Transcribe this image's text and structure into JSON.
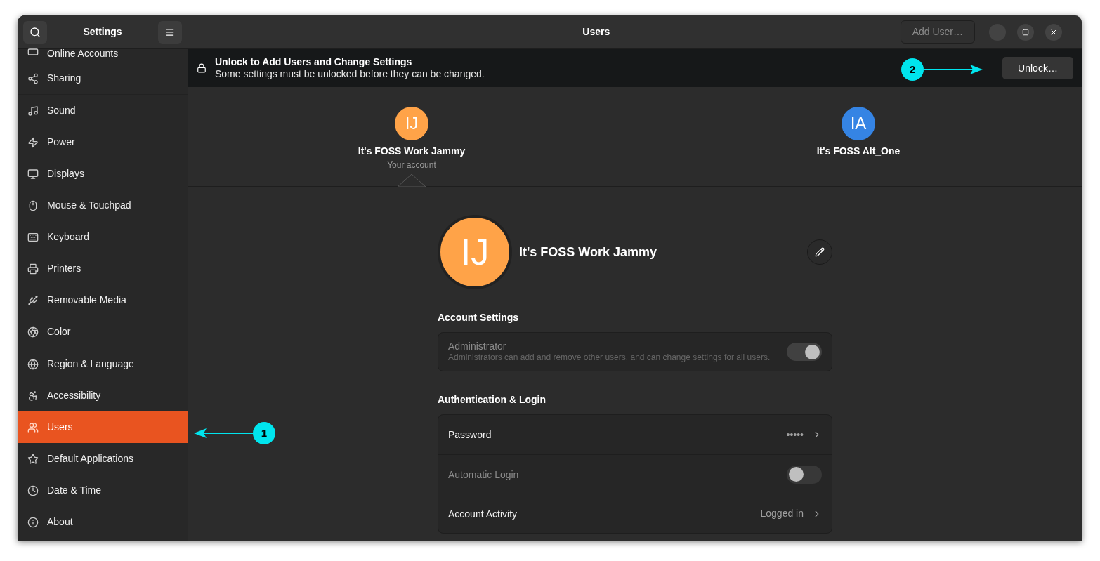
{
  "sidebar": {
    "title": "Settings",
    "groups": [
      [
        {
          "label": "Online Accounts",
          "selected": false
        },
        {
          "label": "Sharing",
          "selected": false
        }
      ],
      [
        {
          "label": "Sound",
          "selected": false
        },
        {
          "label": "Power",
          "selected": false
        },
        {
          "label": "Displays",
          "selected": false
        },
        {
          "label": "Mouse & Touchpad",
          "selected": false
        },
        {
          "label": "Keyboard",
          "selected": false
        },
        {
          "label": "Printers",
          "selected": false
        },
        {
          "label": "Removable Media",
          "selected": false
        },
        {
          "label": "Color",
          "selected": false
        }
      ],
      [
        {
          "label": "Region & Language",
          "selected": false
        },
        {
          "label": "Accessibility",
          "selected": false
        },
        {
          "label": "Users",
          "selected": true
        },
        {
          "label": "Default Applications",
          "selected": false
        },
        {
          "label": "Date & Time",
          "selected": false
        },
        {
          "label": "About",
          "selected": false
        }
      ]
    ]
  },
  "header": {
    "title": "Users",
    "add_button": "Add User…"
  },
  "banner": {
    "title": "Unlock to Add Users and Change Settings",
    "subtitle": "Some settings must be unlocked before they can be changed.",
    "button": "Unlock…"
  },
  "users": [
    {
      "initials": "IJ",
      "name": "It's FOSS Work Jammy",
      "subtitle": "Your account",
      "color": "#ffa348",
      "selected": true
    },
    {
      "initials": "IA",
      "name": "It's FOSS Alt_One",
      "color": "#3584e4",
      "selected": false
    }
  ],
  "profile": {
    "initials": "IJ",
    "name": "It's FOSS Work Jammy"
  },
  "sections": [
    {
      "title": "Account Settings",
      "rows": [
        {
          "kind": "toggle",
          "label": "Administrator",
          "description": "Administrators can add and remove other users, and can change settings for all users.",
          "on": true,
          "disabled": true
        }
      ]
    },
    {
      "title": "Authentication & Login",
      "rows": [
        {
          "kind": "link",
          "label": "Password",
          "value": "•••••",
          "disabled": false
        },
        {
          "kind": "toggle",
          "label": "Automatic Login",
          "on": false,
          "disabled": true
        },
        {
          "kind": "link",
          "label": "Account Activity",
          "value": "Logged in",
          "disabled": false
        }
      ]
    }
  ],
  "annotations": [
    {
      "label": "1"
    },
    {
      "label": "2"
    }
  ]
}
